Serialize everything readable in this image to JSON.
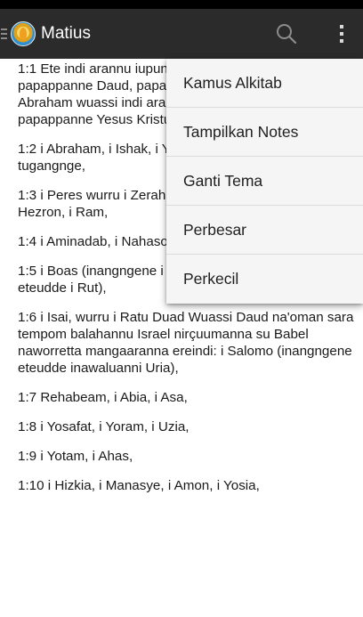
{
  "app_bar": {
    "title": "Matius"
  },
  "icons": {
    "nav": "menu-icon",
    "logo": "app-logo",
    "search": "search-icon",
    "overflow": "more-vert-icon"
  },
  "colors": {
    "app_bar_bg": "#2b2b2b",
    "status_bar_bg": "#000000",
    "menu_bg": "#f5f5f5"
  },
  "verses": [
    "1:1 Ete indi arannu iupungnganna Yesus Kristus, papappanne Daud, papappanne Abraham. Wuassi Abraham wuassi indi arannu manga iupungnganna papappanne Yesus Kristus ereindi:",
    "1:2 i Abraham, i Ishak, i Yakub, i Yehuda manga tugangnge,",
    "1:3 i Peres wurru i Zerah (inangngene aranne Tamar), i Hezron, i Ram,",
    "1:4 i Aminadab, i Nahason, i Salmon,",
    "1:5 i Boas (inangngene i Rahab), i Obed (inangngene eteudde i Rut),",
    "1:6 i Isai, wurru i Ratu Duad Wuassi Daud na'oman sara tempom balahannu Israel nirçuumanna su Babel naworretta mangaaranna ereindi: i Salomo (inangngene eteudde inawaluanni Uria),",
    "1:7 Rehabeam, i Abia, i Asa,",
    "1:8 i Yosafat, i Yoram, i Uzia,",
    "1:9 i Yotam, i Ahas,",
    "1:10 i Hizkia, i Manasye, i Amon, i Yosia,"
  ],
  "overflow_menu": {
    "items": [
      "Kamus Alkitab",
      "Tampilkan Notes",
      "Ganti Tema",
      "Perbesar",
      "Perkecil"
    ]
  }
}
